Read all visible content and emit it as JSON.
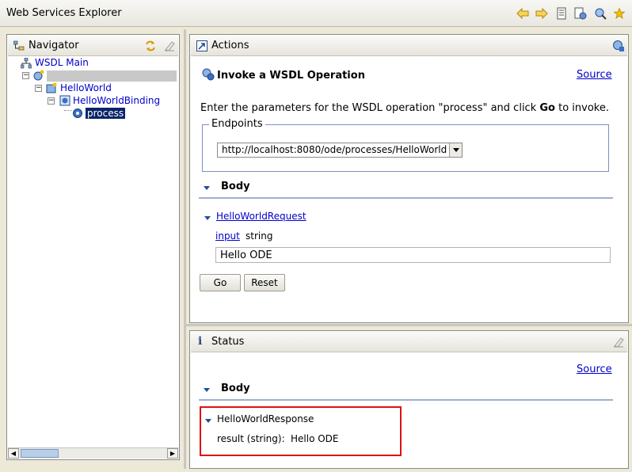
{
  "app": {
    "title": "Web Services Explorer"
  },
  "navigator": {
    "title": "Navigator",
    "tree": {
      "root_label": "WSDL Main",
      "redacted_label": "",
      "service_label": "HelloWorld",
      "binding_label": "HelloWorldBinding",
      "operation_label": "process"
    }
  },
  "actions": {
    "title": "Actions",
    "heading": "Invoke a WSDL Operation",
    "source_link": "Source",
    "instruction_prefix": "Enter the parameters for the WSDL operation \"process\" and click ",
    "instruction_bold": "Go",
    "instruction_suffix": " to invoke.",
    "endpoints_legend": "Endpoints",
    "endpoint_selected": "http://localhost:8080/ode/processes/HelloWorld",
    "body_label": "Body",
    "request_label": "HelloWorldRequest",
    "param_name": "input",
    "param_type": "string",
    "param_value": "Hello ODE",
    "go_label": "Go",
    "reset_label": "Reset"
  },
  "status": {
    "title": "Status",
    "source_link": "Source",
    "body_label": "Body",
    "response_label": "HelloWorldResponse",
    "result_label": "result (string):",
    "result_value": "Hello ODE"
  },
  "colors": {
    "link": "#0000cc",
    "highlight_border": "#dd1111",
    "selected_bg": "#0a246a"
  },
  "icons": [
    "back-arrow-icon",
    "forward-arrow-icon",
    "favorites-icon",
    "wsdl-page-icon",
    "uddi-page-icon",
    "star-icon"
  ]
}
